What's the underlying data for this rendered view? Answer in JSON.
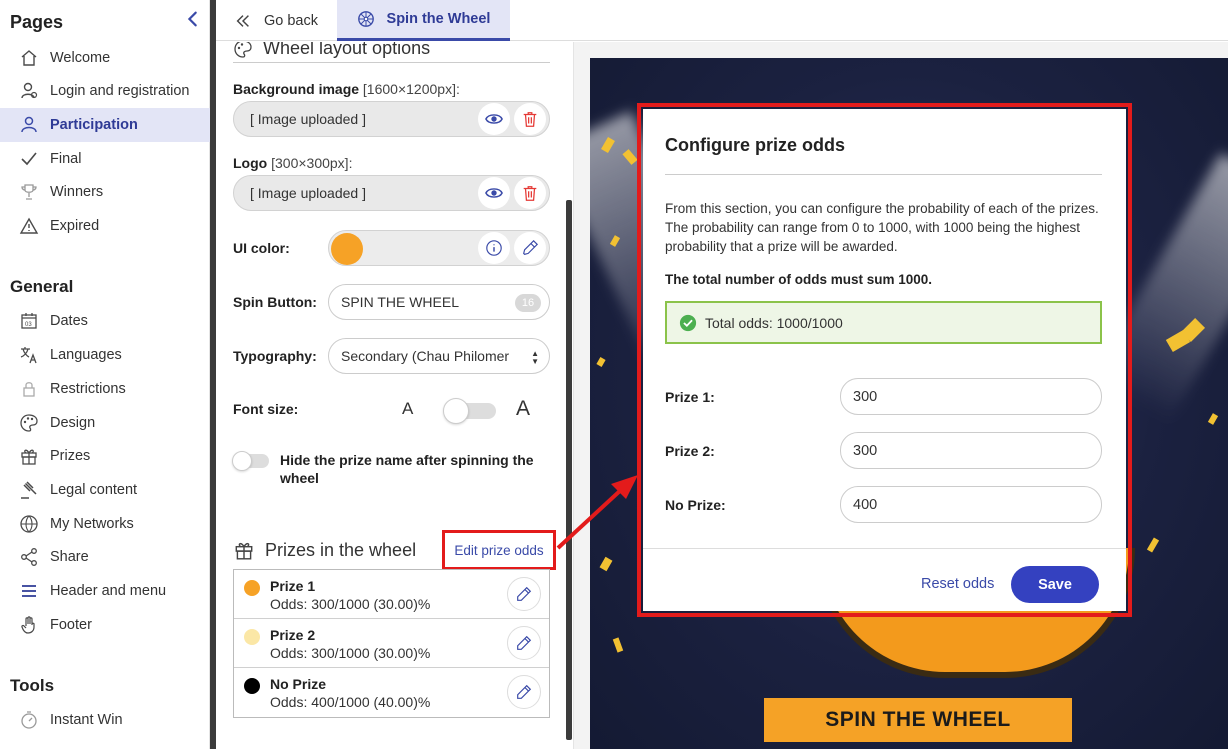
{
  "sidebar": {
    "pages_heading": "Pages",
    "pages": [
      {
        "label": "Welcome",
        "icon": "home-icon"
      },
      {
        "label": "Login and registration",
        "icon": "user-icon"
      },
      {
        "label": "Participation",
        "icon": "users-icon",
        "active": true
      },
      {
        "label": "Final",
        "icon": "check-icon"
      },
      {
        "label": "Winners",
        "icon": "trophy-icon"
      },
      {
        "label": "Expired",
        "icon": "warning-icon"
      }
    ],
    "general_heading": "General",
    "general": [
      {
        "label": "Dates",
        "icon": "calendar-icon"
      },
      {
        "label": "Languages",
        "icon": "translate-icon"
      },
      {
        "label": "Restrictions",
        "icon": "lock-icon"
      },
      {
        "label": "Design",
        "icon": "palette-icon"
      },
      {
        "label": "Prizes",
        "icon": "gift-icon"
      },
      {
        "label": "Legal content",
        "icon": "gavel-icon"
      },
      {
        "label": "My Networks",
        "icon": "globe-icon"
      },
      {
        "label": "Share",
        "icon": "share-icon"
      },
      {
        "label": "Header and menu",
        "icon": "menu-icon"
      },
      {
        "label": "Footer",
        "icon": "hand-icon"
      }
    ],
    "tools_heading": "Tools",
    "tools": [
      {
        "label": "Instant Win",
        "icon": "timer-icon"
      }
    ]
  },
  "topbar": {
    "back_label": "Go back",
    "active_tab_label": "Spin the Wheel"
  },
  "panel": {
    "section_title": "Wheel layout options",
    "bg_label": "Background image",
    "bg_size": "[1600×1200px]:",
    "bg_value": "[ Image uploaded ]",
    "logo_label": "Logo",
    "logo_size": "[300×300px]:",
    "logo_value": "[ Image uploaded ]",
    "ui_color_label": "UI color:",
    "ui_color": "#f6a226",
    "spin_button_label": "Spin Button:",
    "spin_button_value": "SPIN THE WHEEL",
    "spin_button_count": "16",
    "typography_label": "Typography:",
    "typography_value": "Secondary (Chau Philomer",
    "font_size_label": "Font size:",
    "font_small_glyph": "A",
    "font_large_glyph": "A",
    "hide_prize_label": "Hide the prize name after spinning the wheel",
    "prizes_title": "Prizes in the wheel",
    "edit_odds_label": "Edit prize odds",
    "prizes": [
      {
        "name": "Prize 1",
        "odds": "Odds: 300/1000 (30.00)%",
        "color": "#f6a226"
      },
      {
        "name": "Prize 2",
        "odds": "Odds: 300/1000 (30.00)%",
        "color": "#fbe7a6"
      },
      {
        "name": "No Prize",
        "odds": "Odds: 400/1000 (40.00)%",
        "color": "#000000"
      }
    ]
  },
  "preview": {
    "spin_button": "SPIN THE WHEEL"
  },
  "modal": {
    "title": "Configure prize odds",
    "description": "From this section, you can configure the probability of each of the prizes. The probability can range from 0 to 1000, with 1000 being the highest probability that a prize will be awarded.",
    "total_note": "The total number of odds must sum 1000.",
    "status": "Total odds: 1000/1000",
    "fields": [
      {
        "label": "Prize 1:",
        "value": "300"
      },
      {
        "label": "Prize 2:",
        "value": "300"
      },
      {
        "label": "No Prize:",
        "value": "400"
      }
    ],
    "reset_label": "Reset odds",
    "save_label": "Save"
  }
}
